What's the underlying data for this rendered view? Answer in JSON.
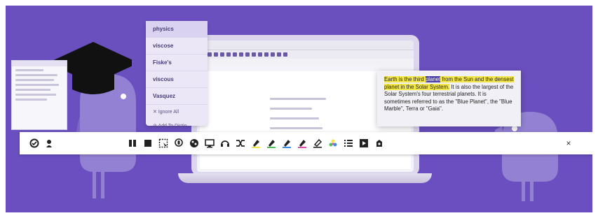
{
  "spelling_menu": {
    "suggestions": [
      "physics",
      "viscose",
      "Fiske's",
      "viscous",
      "Vasquez"
    ],
    "ignore_all_label": "Ignore All",
    "add_to_dictionary_label": "Add To Dictio"
  },
  "popover": {
    "text_pre": "Earth is the third ",
    "text_selected": "planet",
    "text_post_highlight": " from the Sun and the densest planet in the Solar System.",
    "text_rest": " It is also the largest of the Solar System's four terrestrial planets. It is sometimes referred to as the \"Blue Planet\", the \"Blue Marble\", Terra or \"Gaia\"."
  },
  "toolbar": {
    "close_label": "×",
    "tools": [
      "check-spelling-icon",
      "speak-icon",
      "pause-icon",
      "stop-icon",
      "screen-mask-icon",
      "speech-input-icon",
      "picture-dictionary-icon",
      "screenshot-reader-icon",
      "audio-maker-icon",
      "translator-icon",
      "highlight-yellow-icon",
      "highlight-green-icon",
      "highlight-blue-icon",
      "highlight-pink-icon",
      "clear-highlights-icon",
      "collect-highlights-icon",
      "vocabulary-list-icon",
      "video-icon",
      "settings-icon"
    ]
  },
  "colors": {
    "background": "#6a4fbf",
    "accent": "#4a3ca8",
    "highlight_yellow": "#f2e64a",
    "highlight_green": "#4fbf5a",
    "highlight_blue": "#3a8de0",
    "highlight_pink": "#d94fa8"
  }
}
